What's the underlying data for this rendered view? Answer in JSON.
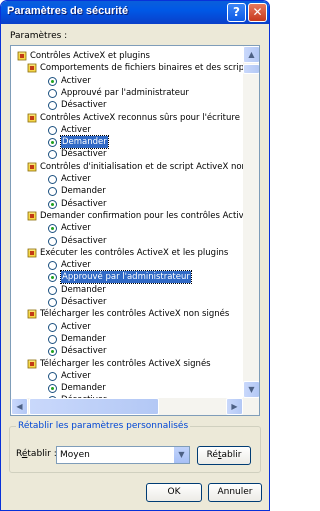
{
  "window": {
    "title": "Paramètres de sécurité",
    "help_label": "?",
    "close_label": "✕"
  },
  "settings_label": "Paramètres :",
  "tree": [
    {
      "type": "category",
      "label": "Contrôles ActiveX et plugins",
      "indent": 0,
      "icon": "lock-icon"
    },
    {
      "type": "setting",
      "label": "Comportements de fichiers binaires et des scripts",
      "indent": 1,
      "icon": "lock-icon"
    },
    {
      "type": "option",
      "label": "Activer",
      "checked": true
    },
    {
      "type": "option",
      "label": "Approuvé par l'administrateur",
      "checked": false
    },
    {
      "type": "option",
      "label": "Désactiver",
      "checked": false
    },
    {
      "type": "setting",
      "label": "Contrôles ActiveX reconnus sûrs pour l'écriture de scrip",
      "indent": 1,
      "icon": "lock-icon"
    },
    {
      "type": "option",
      "label": "Activer",
      "checked": false
    },
    {
      "type": "option",
      "label": "Demander",
      "checked": true,
      "selected": true
    },
    {
      "type": "option",
      "label": "Désactiver",
      "checked": false
    },
    {
      "type": "setting",
      "label": "Contrôles d'initialisation et de script ActiveX non marqu",
      "indent": 1,
      "icon": "lock-icon"
    },
    {
      "type": "option",
      "label": "Activer",
      "checked": false
    },
    {
      "type": "option",
      "label": "Demander",
      "checked": false
    },
    {
      "type": "option",
      "label": "Désactiver",
      "checked": true
    },
    {
      "type": "setting",
      "label": "Demander confirmation pour les contrôles ActiveX",
      "indent": 1,
      "icon": "lock-icon"
    },
    {
      "type": "option",
      "label": "Activer",
      "checked": true
    },
    {
      "type": "option",
      "label": "Désactiver",
      "checked": false
    },
    {
      "type": "setting",
      "label": "Exécuter les contrôles ActiveX et les plugins",
      "indent": 1,
      "icon": "lock-icon"
    },
    {
      "type": "option",
      "label": "Activer",
      "checked": false
    },
    {
      "type": "option",
      "label": "Approuvé par l'administrateur",
      "checked": true,
      "selected": true
    },
    {
      "type": "option",
      "label": "Demander",
      "checked": false
    },
    {
      "type": "option",
      "label": "Désactiver",
      "checked": false
    },
    {
      "type": "setting",
      "label": "Télécharger les contrôles ActiveX non signés",
      "indent": 1,
      "icon": "lock-icon"
    },
    {
      "type": "option",
      "label": "Activer",
      "checked": false
    },
    {
      "type": "option",
      "label": "Demander",
      "checked": false
    },
    {
      "type": "option",
      "label": "Désactiver",
      "checked": true
    },
    {
      "type": "setting",
      "label": "Télécharger les contrôles ActiveX signés",
      "indent": 1,
      "icon": "lock-icon"
    },
    {
      "type": "option",
      "label": "Activer",
      "checked": false
    },
    {
      "type": "option",
      "label": "Demander",
      "checked": true
    },
    {
      "type": "option",
      "label": "Désactiver",
      "checked": false
    }
  ],
  "reset_group": {
    "legend": "Rétablir les paramètres personnalisés",
    "reset_to_label_pre": "R",
    "reset_to_label_u": "é",
    "reset_to_label_post": "tablir :",
    "selected_value": "Moyen",
    "reset_button_pre": "Ré",
    "reset_button_u": "t",
    "reset_button_post": "ablir"
  },
  "buttons": {
    "ok": "OK",
    "cancel": "Annuler"
  },
  "colors": {
    "titlebar": "#0058e6",
    "selection": "#316ac5",
    "dialog_bg": "#ece9d8",
    "radio_dot": "#21a121"
  }
}
